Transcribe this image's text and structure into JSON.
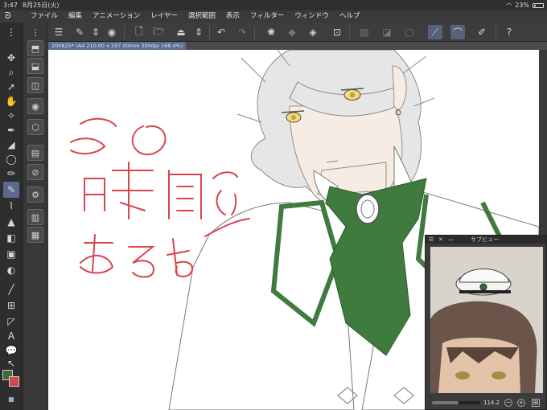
{
  "status": {
    "time": "3:47",
    "date": "8月25日(火)",
    "wifi_icon": "wifi-icon",
    "battery": "23%",
    "battery_level": 0.23
  },
  "menu": [
    "ファイル",
    "編集",
    "アニメーション",
    "レイヤー",
    "選択範囲",
    "表示",
    "フィルター",
    "ウィンドウ",
    "ヘルプ"
  ],
  "document_tab": "200825* (A4 210.00 x 297.00mm 300dpi 168.4%)",
  "sub_view": {
    "title": "サブビュー",
    "zoom": "114.2",
    "zoom_fraction": 0.55
  },
  "colors": {
    "accent": "#5a6a8e",
    "main_color": "#3d6b3a",
    "sub_color": "#d04a4a",
    "ink": "#d8444a",
    "green": "#3f7a3f"
  },
  "handwriting": [
    "この",
    "時間で",
    "あるよ〜"
  ]
}
